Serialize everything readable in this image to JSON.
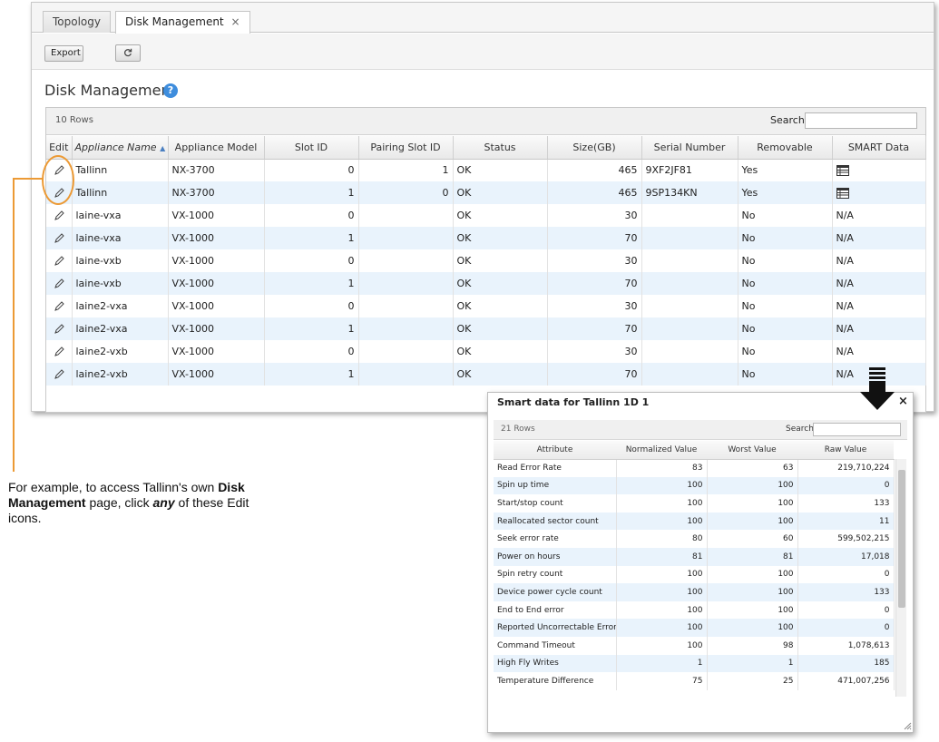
{
  "tabs": [
    {
      "label": "Topology",
      "active": false
    },
    {
      "label": "Disk Management",
      "active": true
    }
  ],
  "toolbar": {
    "export_label": "Export",
    "refresh_icon": "refresh-icon"
  },
  "page": {
    "title": "Disk Management",
    "help_label": "?"
  },
  "grid": {
    "row_count": "10 Rows",
    "search_label": "Search",
    "columns": [
      "Edit",
      "Appliance Name",
      "Appliance Model",
      "Slot ID",
      "Pairing Slot ID",
      "Status",
      "Size(GB)",
      "Serial Number",
      "Removable",
      "SMART Data"
    ],
    "rows": [
      {
        "name": "Tallinn",
        "model": "NX-3700",
        "slot": "0",
        "pairing": "1",
        "status": "OK",
        "size": "465",
        "serial": "9XF2JF81",
        "removable": "Yes",
        "smart": ""
      },
      {
        "name": "Tallinn",
        "model": "NX-3700",
        "slot": "1",
        "pairing": "0",
        "status": "OK",
        "size": "465",
        "serial": "9SP134KN",
        "removable": "Yes",
        "smart": ""
      },
      {
        "name": "laine-vxa",
        "model": "VX-1000",
        "slot": "0",
        "pairing": "",
        "status": "OK",
        "size": "30",
        "serial": "",
        "removable": "No",
        "smart": "N/A"
      },
      {
        "name": "laine-vxa",
        "model": "VX-1000",
        "slot": "1",
        "pairing": "",
        "status": "OK",
        "size": "70",
        "serial": "",
        "removable": "No",
        "smart": "N/A"
      },
      {
        "name": "laine-vxb",
        "model": "VX-1000",
        "slot": "0",
        "pairing": "",
        "status": "OK",
        "size": "30",
        "serial": "",
        "removable": "No",
        "smart": "N/A"
      },
      {
        "name": "laine-vxb",
        "model": "VX-1000",
        "slot": "1",
        "pairing": "",
        "status": "OK",
        "size": "70",
        "serial": "",
        "removable": "No",
        "smart": "N/A"
      },
      {
        "name": "laine2-vxa",
        "model": "VX-1000",
        "slot": "0",
        "pairing": "",
        "status": "OK",
        "size": "30",
        "serial": "",
        "removable": "No",
        "smart": "N/A"
      },
      {
        "name": "laine2-vxa",
        "model": "VX-1000",
        "slot": "1",
        "pairing": "",
        "status": "OK",
        "size": "70",
        "serial": "",
        "removable": "No",
        "smart": "N/A"
      },
      {
        "name": "laine2-vxb",
        "model": "VX-1000",
        "slot": "0",
        "pairing": "",
        "status": "OK",
        "size": "30",
        "serial": "",
        "removable": "No",
        "smart": "N/A"
      },
      {
        "name": "laine2-vxb",
        "model": "VX-1000",
        "slot": "1",
        "pairing": "",
        "status": "OK",
        "size": "70",
        "serial": "",
        "removable": "No",
        "smart": "N/A"
      }
    ]
  },
  "callout": {
    "text_before": "For example, to access Tallinn's own ",
    "bold": "Disk Management",
    "text_mid": " page, click ",
    "emphasis": "any",
    "text_after": " of these Edit icons."
  },
  "smart_popup": {
    "title": "Smart data for Tallinn 1D 1",
    "close_label": "×",
    "row_count": "21 Rows",
    "search_label": "Search",
    "columns": [
      "Attribute",
      "Normalized Value",
      "Worst Value",
      "Raw Value"
    ],
    "rows": [
      {
        "attribute": "Read Error Rate",
        "normalized": "83",
        "worst": "63",
        "raw": "219,710,224"
      },
      {
        "attribute": "Spin up time",
        "normalized": "100",
        "worst": "100",
        "raw": "0"
      },
      {
        "attribute": "Start/stop count",
        "normalized": "100",
        "worst": "100",
        "raw": "133"
      },
      {
        "attribute": "Reallocated sector count",
        "normalized": "100",
        "worst": "100",
        "raw": "11"
      },
      {
        "attribute": "Seek error rate",
        "normalized": "80",
        "worst": "60",
        "raw": "599,502,215"
      },
      {
        "attribute": "Power on hours",
        "normalized": "81",
        "worst": "81",
        "raw": "17,018"
      },
      {
        "attribute": "Spin retry count",
        "normalized": "100",
        "worst": "100",
        "raw": "0"
      },
      {
        "attribute": "Device power cycle count",
        "normalized": "100",
        "worst": "100",
        "raw": "133"
      },
      {
        "attribute": "End to End error",
        "normalized": "100",
        "worst": "100",
        "raw": "0"
      },
      {
        "attribute": "Reported Uncorrectable Errors",
        "normalized": "100",
        "worst": "100",
        "raw": "0"
      },
      {
        "attribute": "Command Timeout",
        "normalized": "100",
        "worst": "98",
        "raw": "1,078,613"
      },
      {
        "attribute": "High Fly Writes",
        "normalized": "1",
        "worst": "1",
        "raw": "185"
      },
      {
        "attribute": "Temperature Difference",
        "normalized": "75",
        "worst": "25",
        "raw": "471,007,256"
      }
    ]
  },
  "colors": {
    "accent": "#3e8ddd",
    "callout": "#ec9a35",
    "row_alt": "#e9f3fc"
  }
}
